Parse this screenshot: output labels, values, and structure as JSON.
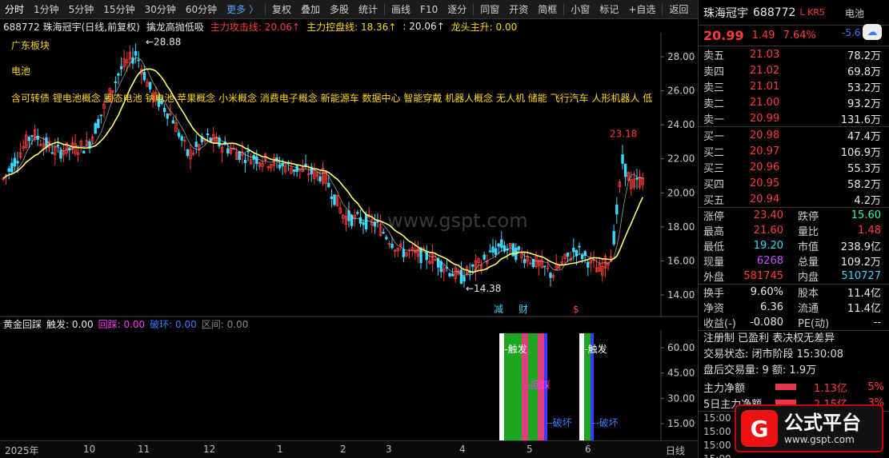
{
  "toolbar": {
    "items": [
      "分时",
      "1分钟",
      "5分钟",
      "15分钟",
      "30分钟",
      "60分钟",
      "更多 〉",
      "复权",
      "叠加",
      "多股",
      "统计",
      "画线",
      "F10",
      "逐分",
      "同窗",
      "开资",
      "简框",
      "小窗",
      "标记",
      "+自选",
      "返回"
    ]
  },
  "chart_header": {
    "stock": "688772 珠海冠宇(日线,前复权)",
    "indicator": "擒龙高抛低吸",
    "attack": "主力攻击线: 20.06↑",
    "control": "主力控盘线: 18.36↑",
    "colon_val": ": 20.06↑",
    "dragon": "龙头主升: 0.00"
  },
  "overlay": {
    "sector": "广东板块",
    "battery": "电池",
    "concepts": "含可转债  锂电池概念  固态电池  钠电池  苹果概念  小米概念  消费电子概念  新能源车  数据中心  智能穿戴  机器人概念  无人机  储能  飞行汽车  人形机器人  低"
  },
  "kline_axis": [
    "28.00",
    "26.00",
    "24.00",
    "22.00",
    "20.00",
    "18.00",
    "16.00",
    "14.00"
  ],
  "kline_labels": {
    "high": "28.88",
    "low": "14.38",
    "recent_high": "23.18"
  },
  "kline_markers": {
    "jian": "减",
    "cai": "财",
    "s": "$"
  },
  "watermark": "www.gspt.com",
  "indicator_header": {
    "name": "黄金回踩",
    "trigger": "触发: 0.00",
    "pullback": "回踩: 0.00",
    "break": "破环: 0.00",
    "range": "区间: 0.00"
  },
  "ind_axis": [
    "60.00",
    "45.00",
    "30.00",
    "15.00"
  ],
  "ind_labels": {
    "trigger": "触发",
    "pullback": "回踩",
    "break": "破坏"
  },
  "time_axis": [
    "2025年",
    "10",
    "11",
    "12",
    "1",
    "2",
    "3",
    "4",
    "5",
    "6",
    "日线"
  ],
  "right_panel": {
    "name": "珠海冠宇",
    "code": "688772",
    "tag": "L KR5",
    "battery_tab": "电池",
    "battery_val": "-5.6",
    "price": "20.99",
    "change": "1.49",
    "pct": "7.64%",
    "asks": [
      {
        "k": "卖五",
        "v": "21.03",
        "q": "78.2万"
      },
      {
        "k": "卖四",
        "v": "21.02",
        "q": "69.8万"
      },
      {
        "k": "卖三",
        "v": "21.01",
        "q": "53.2万"
      },
      {
        "k": "卖二",
        "v": "21.00",
        "q": "93.2万"
      },
      {
        "k": "卖一",
        "v": "20.99",
        "q": "131.6万"
      }
    ],
    "bids": [
      {
        "k": "买一",
        "v": "20.98",
        "q": "47.4万"
      },
      {
        "k": "买二",
        "v": "20.97",
        "q": "106.9万"
      },
      {
        "k": "买三",
        "v": "20.96",
        "q": "55.3万"
      },
      {
        "k": "买四",
        "v": "20.95",
        "q": "58.2万"
      },
      {
        "k": "买五",
        "v": "20.94",
        "q": "4.2万"
      }
    ],
    "stats1": [
      {
        "k": "涨停",
        "v": "23.40",
        "k2": "跌停",
        "v2": "15.60",
        "c": "#ff3b3b",
        "c2": "#3bff8a"
      },
      {
        "k": "最高",
        "v": "21.60",
        "k2": "量比",
        "v2": "1.48",
        "c": "#ff3b3b",
        "c2": "#ff3b3b"
      },
      {
        "k": "最低",
        "v": "19.20",
        "k2": "市值",
        "v2": "238.9亿",
        "c": "#3bd8ff",
        "c2": "#e8e8e8"
      },
      {
        "k": "现量",
        "v": "6268",
        "k2": "总量",
        "v2": "109.2万",
        "c": "#c84bff",
        "c2": "#e8e8e8"
      },
      {
        "k": "外盘",
        "v": "581745",
        "k2": "内盘",
        "v2": "510727",
        "c": "#ff3b3b",
        "c2": "#3bd8ff"
      }
    ],
    "stats2": [
      {
        "k": "换手",
        "v": "9.60%",
        "k2": "股本",
        "v2": "11.4亿"
      },
      {
        "k": "净资",
        "v": "6.36",
        "k2": "流通",
        "v2": "11.4亿"
      },
      {
        "k": "收益(-)",
        "v": "-0.080",
        "k2": "PE(动)",
        "v2": "--"
      }
    ],
    "info": [
      "注册制 已盈利 表决权无差异",
      "交易状态: 闭市阶段 15:30:08",
      "盘后交易量: 9  额: 1.9万"
    ],
    "flows": [
      {
        "k": "主力净额",
        "v": "1.13亿",
        "pct": "5%"
      },
      {
        "k": "5日主力净额",
        "v": "2.15亿",
        "pct": "3%"
      }
    ],
    "ticks": [
      "15:00     20.99  1315.7万",
      "15:00",
      "15:00",
      "15:00",
      "15:00"
    ]
  },
  "brand": {
    "title": "公式平台",
    "url": "www.gspt.com",
    "logo": "G"
  },
  "colors": {
    "up": "#ff3b3b",
    "down": "#3bd8ff",
    "ma": "#ffff6a",
    "bg": "#000000"
  }
}
